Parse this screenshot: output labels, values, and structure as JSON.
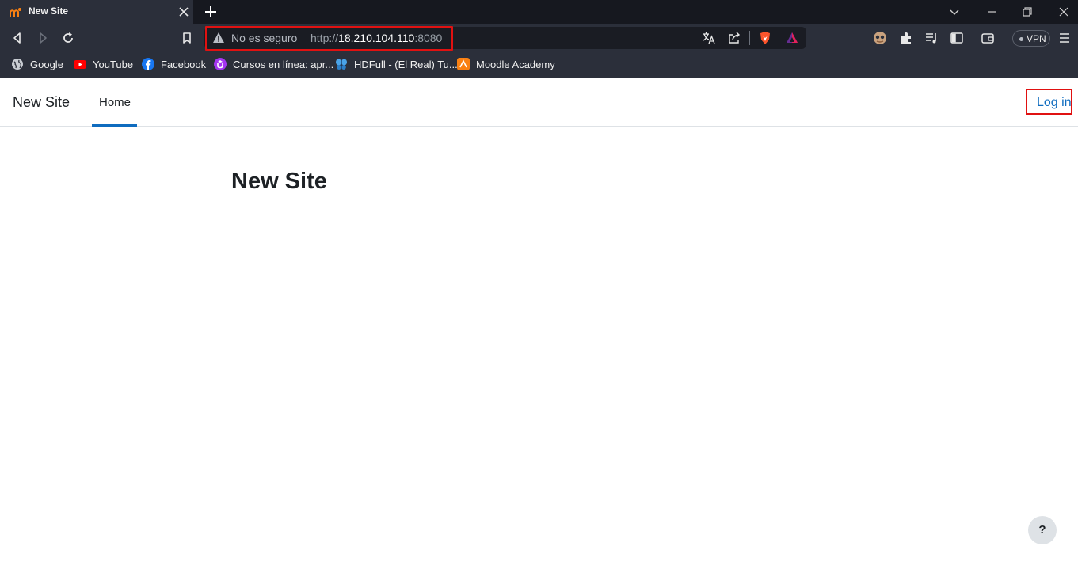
{
  "browser": {
    "tab": {
      "title": "New Site"
    },
    "address_bar": {
      "security_label": "No es seguro",
      "scheme": "http://",
      "host": "18.210.104.110",
      "port": ":8080"
    },
    "vpn_label": "VPN",
    "bookmarks": [
      {
        "label": "Google",
        "icon": "globe-icon"
      },
      {
        "label": "YouTube",
        "icon": "youtube-icon"
      },
      {
        "label": "Facebook",
        "icon": "facebook-icon"
      },
      {
        "label": "Cursos en línea: apr...",
        "icon": "udemy-icon"
      },
      {
        "label": "HDFull - (El Real) Tu...",
        "icon": "butterfly-icon"
      },
      {
        "label": "Moodle Academy",
        "icon": "moodle-icon"
      }
    ]
  },
  "site": {
    "brand": "New Site",
    "nav": {
      "home_label": "Home"
    },
    "login_label": "Log in",
    "heading": "New Site",
    "help_label": "?"
  },
  "colors": {
    "chrome_dark": "#16181f",
    "chrome": "#2b2f3a",
    "omnibox": "#1a1c23",
    "accent": "#0f6cbf",
    "annotation_red": "#e01111"
  }
}
